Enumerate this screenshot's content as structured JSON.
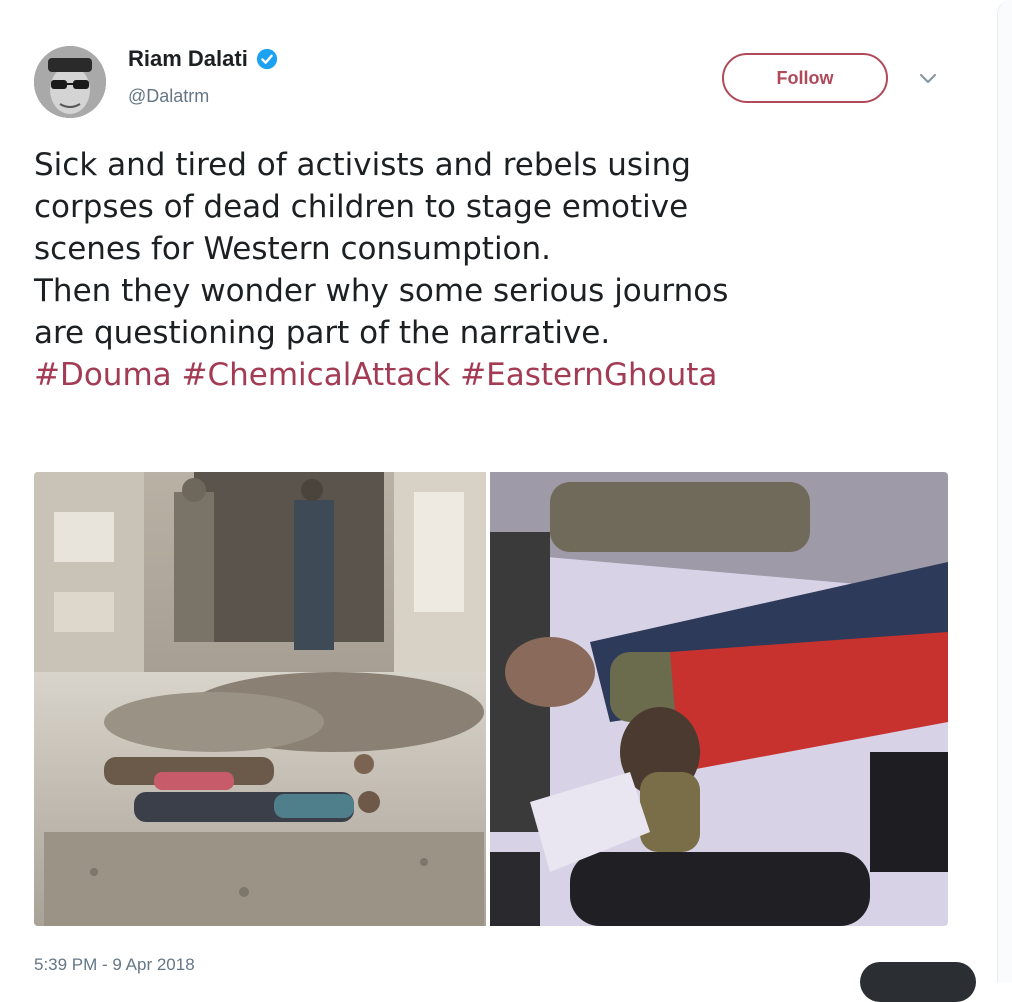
{
  "author": {
    "display_name": "Riam Dalati",
    "handle": "@Dalatrm",
    "verified": true
  },
  "actions": {
    "follow_label": "Follow",
    "menu_icon": "chevron-down-icon"
  },
  "tweet": {
    "lines": [
      "Sick and tired of activists and rebels using",
      "corpses of dead children to stage emotive",
      "scenes for Western consumption.",
      "Then they wonder why some serious journos",
      "are questioning part of the narrative."
    ],
    "hashtags": [
      "#Douma",
      "#ChemicalAttack",
      "#EasternGhouta"
    ],
    "timestamp": "5:39 PM - 9 Apr 2018"
  },
  "media": {
    "count": 2
  },
  "colors": {
    "hashtag": "#a33b54",
    "follow_border": "#b04a5a",
    "secondary_text": "#657786",
    "verified_badge": "#1da1f2"
  }
}
